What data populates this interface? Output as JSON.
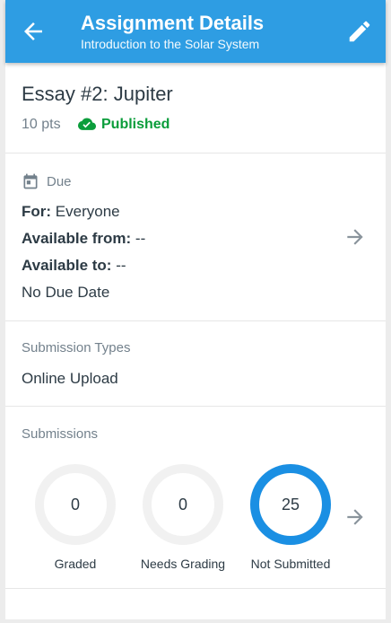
{
  "header": {
    "title": "Assignment Details",
    "subtitle": "Introduction to the Solar System",
    "back_icon": "arrow-back-icon",
    "edit_icon": "pencil-icon",
    "color": "#2e9de3"
  },
  "assignment": {
    "title": "Essay #2: Jupiter",
    "points": "10 pts",
    "status": "Published",
    "status_color": "#0b9d3b"
  },
  "due": {
    "label": "Due",
    "for_label": "For:",
    "for_value": "Everyone",
    "available_from_label": "Available from:",
    "available_from_value": "--",
    "available_to_label": "Available to:",
    "available_to_value": "--",
    "due_date": "No Due Date"
  },
  "submission_types": {
    "label": "Submission Types",
    "value": "Online Upload"
  },
  "submissions": {
    "label": "Submissions",
    "accent_color": "#1a8fe3",
    "items": [
      {
        "count": "0",
        "label": "Graded",
        "fraction": 0
      },
      {
        "count": "0",
        "label": "Needs Grading",
        "fraction": 0
      },
      {
        "count": "25",
        "label": "Not Submitted",
        "fraction": 1
      }
    ]
  }
}
